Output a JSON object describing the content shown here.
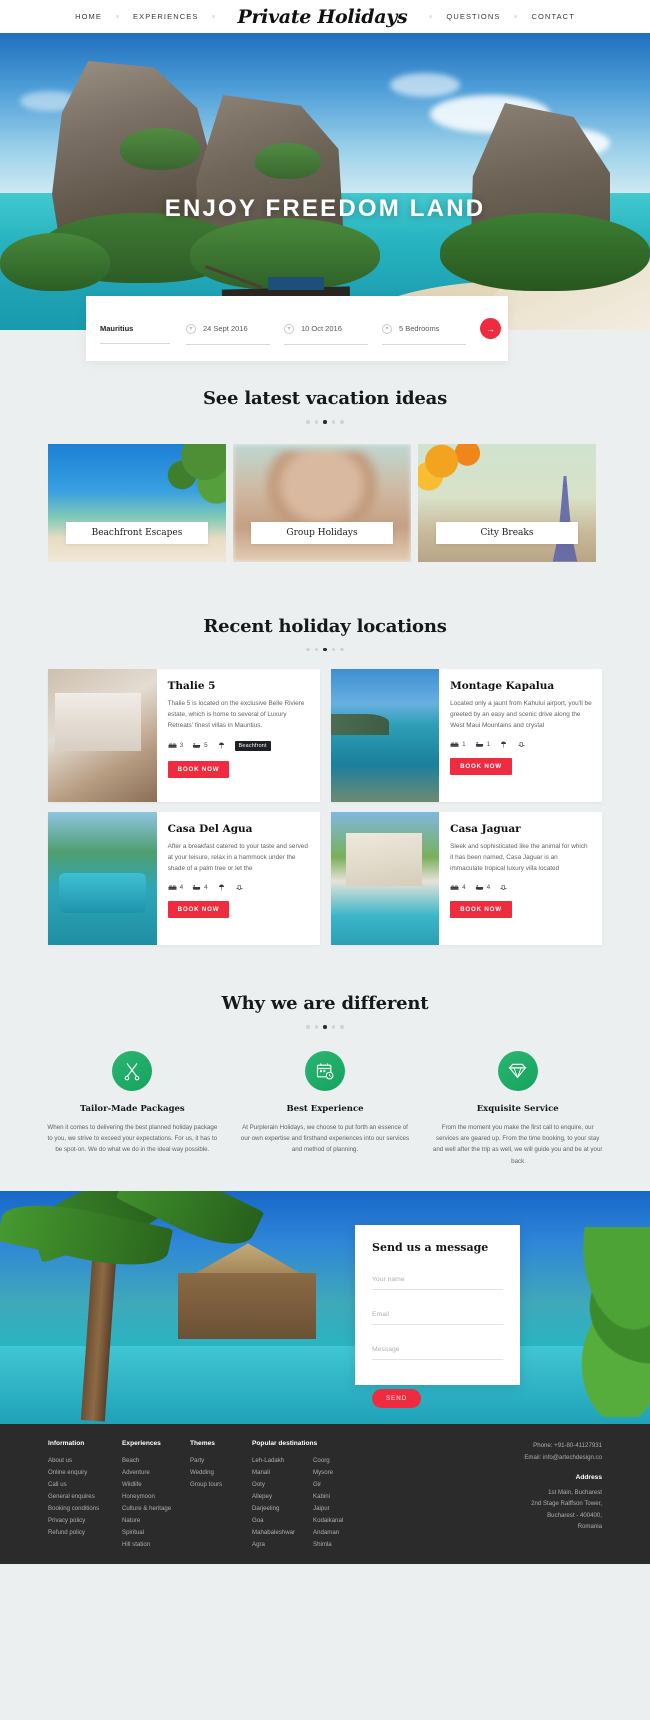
{
  "nav": {
    "brand": "Private Holidays",
    "left": [
      {
        "label": "HOME"
      },
      {
        "label": "EXPERIENCES"
      }
    ],
    "right": [
      {
        "label": "QUESTIONS"
      },
      {
        "label": "CONTACT"
      }
    ]
  },
  "hero": {
    "title": "ENJOY FREEDOM LAND"
  },
  "search": {
    "destination": "Mauritius",
    "check_in": "24 Sept 2016",
    "check_out": "10 Oct 2016",
    "bedrooms": "5 Bedrooms",
    "submit_icon": "arrow-right-icon"
  },
  "ideas": {
    "title": "See latest vacation ideas",
    "dots": 5,
    "active_dot": 2,
    "cards": [
      {
        "label": "Beachfront Escapes"
      },
      {
        "label": "Group Holidays"
      },
      {
        "label": "City Breaks"
      }
    ]
  },
  "locations": {
    "title": "Recent holiday locations",
    "dots": 5,
    "active_dot": 2,
    "book_label": "BOOK NOW",
    "cards": [
      {
        "title": "Thalie 5",
        "desc": "Thalie 5 is located on the exclusive Belle Riviere estate, which is home to several of Luxury Retreats' finest villas in Mauritius.",
        "beds": "3",
        "baths": "5",
        "badge": "Beachfront"
      },
      {
        "title": "Montage Kapalua",
        "desc": "Located only a jaunt from Kahului airport, you'll be greeted by an easy and scenic drive along the West Maui Mountains and crystal",
        "beds": "1",
        "baths": "1",
        "badge": ""
      },
      {
        "title": "Casa Del Agua",
        "desc": "After a breakfast catered to your taste and served at your leisure, relax in a hammock under the shade of a palm tree or let the",
        "beds": "4",
        "baths": "4",
        "badge": ""
      },
      {
        "title": "Casa Jaguar",
        "desc": "Sleek and sophisticated like the animal for which it has been named, Casa Jaguar is an immaculate tropical luxury villa located",
        "beds": "4",
        "baths": "4",
        "badge": ""
      }
    ]
  },
  "features": {
    "title": "Why we are different",
    "dots": 5,
    "active_dot": 2,
    "items": [
      {
        "icon": "scissors-tailor-icon",
        "title": "Tailor-Made Packages",
        "desc": "When it comes to delivering the best planned holiday package to you, we strive to exceed your expectations. For us, it has to be spot-on. We do what we do in the ideal way possible."
      },
      {
        "icon": "calendar-clock-icon",
        "title": "Best Experience",
        "desc": "At Purplerain Holidays, we choose to put forth an essence of our own expertise and firsthand experiences into our services and method of planning."
      },
      {
        "icon": "diamond-icon",
        "title": "Exquisite Service",
        "desc": "From the moment you make the first call to enquire, our services are geared up. From the time booking, to your stay and well after the trip as well, we will guide you and be at your back"
      }
    ]
  },
  "contact": {
    "title": "Send us a message",
    "fields": [
      {
        "name": "your-name",
        "placeholder": "Your name",
        "value": ""
      },
      {
        "name": "email",
        "placeholder": "Email",
        "value": ""
      },
      {
        "name": "message",
        "placeholder": "Message",
        "value": ""
      }
    ],
    "send_label": "SEND"
  },
  "footer": {
    "information": {
      "heading": "Information",
      "items": [
        "About us",
        "Online enquiry",
        "Call us",
        "General enquires",
        "Booking conditions",
        "Privacy policy",
        "Refund policy"
      ]
    },
    "experiences": {
      "heading": "Experiences",
      "items": [
        "Beach",
        "Adventure",
        "Wildlife",
        "Honeymoon",
        "Culture & heritage",
        "Nature",
        "Spiritual",
        "Hill station"
      ]
    },
    "themes": {
      "heading": "Themes",
      "items": [
        "Party",
        "Wedding",
        "Group tours"
      ]
    },
    "destinations": {
      "heading": "Popular destinations",
      "col1": [
        "Leh-Ladakh",
        "Manali",
        "Ooty",
        "Allepey",
        "Darjeeling",
        "Goa",
        "Mahabaleshwar",
        "Agra"
      ],
      "col2": [
        "Coorg",
        "Mysore",
        "Gir",
        "Kabini",
        "Jaipur",
        "Kodaikanal",
        "Andaman",
        "Shimla"
      ]
    },
    "contact": {
      "phone": "Phone: +91-80-41127931",
      "email": "Email: info@artechdesign.co",
      "address_heading": "Address",
      "address_lines": [
        "1st Main, Bucharest",
        "2nd Stage Ralffson Tower,",
        "Bucharest - 400400,",
        "Romania"
      ]
    }
  }
}
